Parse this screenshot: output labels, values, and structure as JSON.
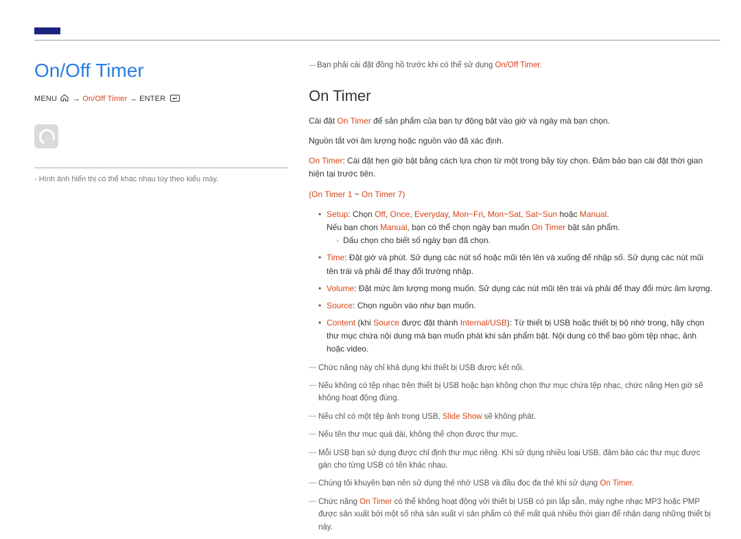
{
  "header": {
    "title": "On/Off Timer"
  },
  "leftPane": {
    "menuLabel": "MENU",
    "arrow1": "→",
    "pathSegment": "On/Off Timer",
    "arrow2": "→",
    "enterLabel": "ENTER",
    "footnote": "- Hình ảnh hiển thị có thể khác nhau tùy theo kiểu máy."
  },
  "top": {
    "preNote": "Bạn phải cài đặt đồng hồ trước khi có thể sử dụng ",
    "preNoteRed": "On/Off Timer",
    "preNoteTail": "."
  },
  "section": {
    "heading": "On Timer",
    "para1a": "Cài đặt ",
    "para1b": "On Timer",
    "para1c": " để sản phẩm của bạn tự động bật vào giờ và ngày mà bạn chọn.",
    "para2": "Nguồn tắt với âm lượng hoặc nguồn vào đã xác định.",
    "para3a": "On Timer",
    "para3b": ": Cài đặt hẹn giờ bật bằng cách lựa chọn từ một trong bảy tùy chọn. Đảm bảo bạn cài đặt thời gian hiện tại trước tiên.",
    "rangeA": "(On Timer 1",
    "rangeB": " ~ ",
    "rangeC": "On Timer 7)",
    "b1": {
      "label": "Setup",
      "t1": ": Chọn ",
      "opt1": "Off",
      "c1": ", ",
      "opt2": "Once",
      "c2": ", ",
      "opt3": "Everyday",
      "c3": ", ",
      "opt4": "Mon~Fri",
      "c4": ", ",
      "opt5": "Mon~Sat",
      "c5": ", ",
      "opt6": "Sat~Sun",
      "t2": " hoặc ",
      "opt7": "Manual",
      "t3": ".",
      "line2a": "Nếu bạn chọn ",
      "line2red": "Manual",
      "line2b": ", bạn có thể chọn ngày bạn muốn ",
      "line2red2": "On Timer",
      "line2c": " bật sản phẩm.",
      "sub": "Dấu chọn cho biết số ngày bạn đã chọn."
    },
    "b2": {
      "label": "Time",
      "text": ": Đặt giờ và phút. Sử dụng các nút số hoặc mũi tên lên và xuống để nhập số. Sử dụng các nút mũi tên trái và phải để thay đổi trường nhập."
    },
    "b3": {
      "label": "Volume",
      "text": ": Đặt mức âm lượng mong muốn. Sử dụng các nút mũi tên trái và phải để thay đổi mức âm lượng."
    },
    "b4": {
      "label": "Source",
      "text": ": Chọn nguồn vào như bạn muốn."
    },
    "b5": {
      "label": "Content",
      "t1": " (khi ",
      "red2": "Source",
      "t2": " được đặt thành ",
      "red3": "Internal/USB",
      "t3": "): Từ thiết bị USB hoặc thiết bị bộ nhớ trong, hãy chọn thư mục chứa nội dung mà bạn muốn phát khi sản phẩm bật. Nội dung có thể bao gồm tệp nhạc, ảnh hoặc video."
    }
  },
  "notes": {
    "n1": "Chức năng này chỉ khả dụng khi thiết bị USB được kết nối.",
    "n2": "Nếu không có tệp nhạc trên thiết bị USB hoặc bạn không chọn thư mục chứa tệp nhạc, chức năng Hẹn giờ sẽ không hoạt động đúng.",
    "n3a": "Nếu chỉ có một tệp ảnh trong USB, ",
    "n3red": "Slide Show",
    "n3b": " sẽ không phát.",
    "n4": "Nếu tên thư mục quá dài, không thể chọn được thư mục.",
    "n5": "Mỗi USB bạn sử dụng được chỉ định thư mục riêng. Khi sử dụng nhiều loại USB, đảm bảo các thư mục được gán cho từng USB có tên khác nhau.",
    "n6a": "Chúng tôi khuyên bạn nên sử dụng thẻ nhớ USB và đầu đọc đa thẻ khi sử dụng ",
    "n6red": "On Timer",
    "n6b": ".",
    "n7a": "Chức năng ",
    "n7red": "On Timer",
    "n7b": " có thể không hoạt động với thiết bị USB có pin lắp sẵn, máy nghe nhạc MP3 hoặc PMP được sản xuất bởi một số nhà sản xuất vì sản phẩm có thể mất quá nhiều thời gian để nhận dạng những thiết bị này."
  }
}
